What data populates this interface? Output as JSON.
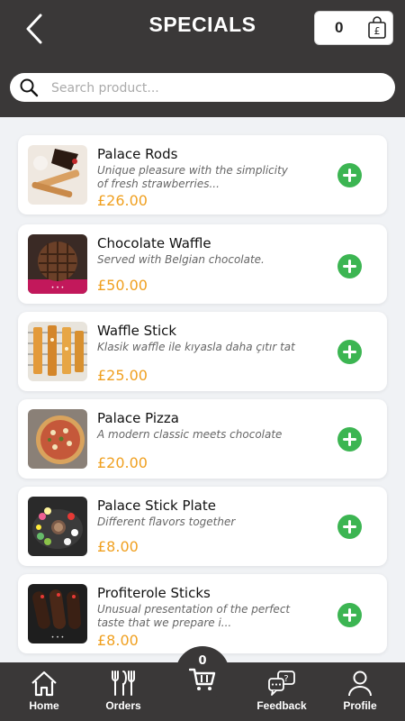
{
  "header": {
    "title": "SPECIALS",
    "cart_count": "0"
  },
  "search": {
    "placeholder": "Search product...",
    "value": ""
  },
  "products": [
    {
      "name": "Palace Rods",
      "description": "Unique pleasure with the simplicity of fresh strawberries...",
      "price": "£26.00"
    },
    {
      "name": "Chocolate Waffle",
      "description": "Served with Belgian chocolate.",
      "price": "£50.00"
    },
    {
      "name": "Waffle Stick",
      "description": "Klasik waffle ile kıyasla daha çıtır tat",
      "price": "£25.00"
    },
    {
      "name": "Palace Pizza",
      "description": "A modern classic meets chocolate",
      "price": "£20.00"
    },
    {
      "name": "Palace Stick Plate",
      "description": "Different flavors together",
      "price": "£8.00"
    },
    {
      "name": "Profiterole Sticks",
      "description": "Unusual presentation of the perfect taste that we prepare i...",
      "price": "£8.00"
    }
  ],
  "bottom_nav": {
    "home": "Home",
    "orders": "Orders",
    "cart_count": "0",
    "feedback": "Feedback",
    "profile": "Profile"
  },
  "colors": {
    "header_bg": "#3a3838",
    "price": "#f0a020",
    "add_button": "#3cb552",
    "page_bg": "#f0f2f5"
  },
  "icons": [
    "back-arrow-icon",
    "pound-bag-icon",
    "search-icon",
    "plus-icon",
    "home-icon",
    "cutlery-icon",
    "cart-icon",
    "feedback-icon",
    "profile-icon"
  ]
}
